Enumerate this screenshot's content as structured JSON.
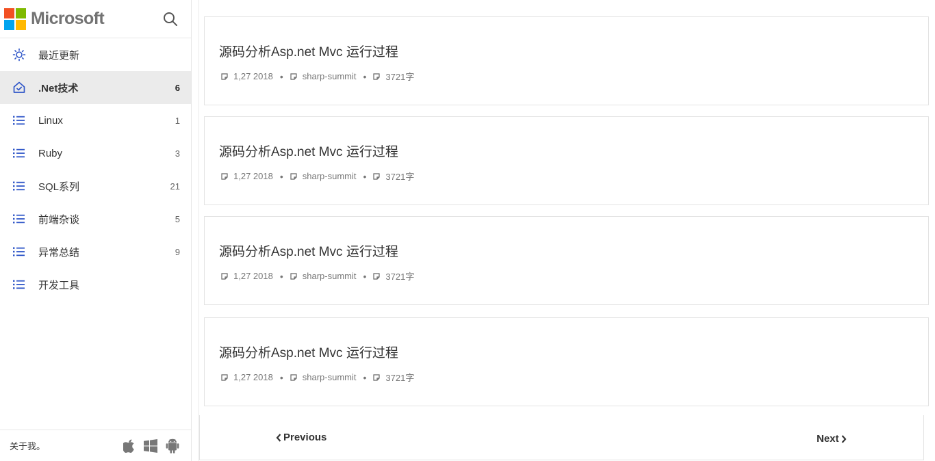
{
  "brand": {
    "name": "Microsoft",
    "logo_colors": [
      "#f25022",
      "#7fba00",
      "#00a4ef",
      "#ffb900"
    ]
  },
  "search": {
    "icon": "search-icon"
  },
  "nav": {
    "items": [
      {
        "label": "最近更新",
        "count": "",
        "icon": "sun-icon",
        "active": false
      },
      {
        "label": ".Net技术",
        "count": "6",
        "icon": "home-icon",
        "active": true
      },
      {
        "label": "Linux",
        "count": "1",
        "icon": "list-icon",
        "active": false
      },
      {
        "label": "Ruby",
        "count": "3",
        "icon": "list-icon",
        "active": false
      },
      {
        "label": "SQL系列",
        "count": "21",
        "icon": "list-icon",
        "active": false
      },
      {
        "label": "前端杂谈",
        "count": "5",
        "icon": "list-icon",
        "active": false
      },
      {
        "label": "异常总结",
        "count": "9",
        "icon": "list-icon",
        "active": false
      },
      {
        "label": "开发工具",
        "count": "",
        "icon": "list-icon",
        "active": false
      }
    ],
    "accent_color": "#2f56c8"
  },
  "footer": {
    "about": "关于我。",
    "icons": [
      "apple-icon",
      "windows-icon",
      "android-icon"
    ]
  },
  "posts": [
    {
      "title": "源码分析Asp.net Mvc 运行过程",
      "date": "1,27 2018",
      "author": "sharp-summit",
      "words": "3721字"
    },
    {
      "title": "源码分析Asp.net Mvc 运行过程",
      "date": "1,27 2018",
      "author": "sharp-summit",
      "words": "3721字"
    },
    {
      "title": "源码分析Asp.net Mvc 运行过程",
      "date": "1,27 2018",
      "author": "sharp-summit",
      "words": "3721字"
    },
    {
      "title": "源码分析Asp.net Mvc 运行过程",
      "date": "1,27 2018",
      "author": "sharp-summit",
      "words": "3721字"
    }
  ],
  "pager": {
    "previous": "Previous",
    "next": "Next"
  }
}
